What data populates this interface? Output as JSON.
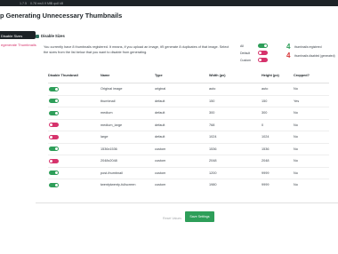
{
  "topbar": {
    "items": [
      "",
      "1.7.5",
      "0.78 ms",
      "0.9 MB",
      "3 qu",
      "8 kB"
    ]
  },
  "page": {
    "title": "p Generating Unnecessary Thumbnails"
  },
  "sidebar": {
    "items": [
      {
        "label": "Disable Sizes",
        "active": true
      },
      {
        "label": "egenerate Thumbnails",
        "active": false
      }
    ]
  },
  "section": {
    "title": "Disable Sizes",
    "description": "You currently have 8 thumbnails registered. It means, if you upload an image, it'll generate 8 duplicates of that image. Select the sizes from the list below that you want to disable from generating."
  },
  "filters": [
    {
      "label": "All",
      "state": "on"
    },
    {
      "label": "Default",
      "state": "off"
    },
    {
      "label": "Custom",
      "state": "off"
    }
  ],
  "counts": [
    {
      "value": "4",
      "label": "thumbnails registered",
      "color": "#2e9e59"
    },
    {
      "value": "4",
      "label": "thumbnails disabled (generated)",
      "color": "#d63638"
    }
  ],
  "table": {
    "headers": [
      "Disable Thumbnail",
      "Name",
      "Type",
      "Width (px)",
      "Height (px)",
      "Cropped?"
    ],
    "rows": [
      {
        "toggle": "on",
        "name": "Original image",
        "type": "original",
        "width": "auto",
        "height": "auto",
        "cropped": "No"
      },
      {
        "toggle": "on",
        "name": "thumbnail",
        "type": "default",
        "width": "150",
        "height": "150",
        "cropped": "Yes"
      },
      {
        "toggle": "on",
        "name": "medium",
        "type": "default",
        "width": "300",
        "height": "300",
        "cropped": "No"
      },
      {
        "toggle": "off",
        "name": "medium_large",
        "type": "default",
        "width": "768",
        "height": "0",
        "cropped": "No"
      },
      {
        "toggle": "off",
        "name": "large",
        "type": "default",
        "width": "1024",
        "height": "1024",
        "cropped": "No"
      },
      {
        "toggle": "on",
        "name": "1536x1536",
        "type": "custom",
        "width": "1536",
        "height": "1536",
        "cropped": "No"
      },
      {
        "toggle": "off",
        "name": "2048x2048",
        "type": "custom",
        "width": "2048",
        "height": "2048",
        "cropped": "No"
      },
      {
        "toggle": "on",
        "name": "post-thumbnail",
        "type": "custom",
        "width": "1200",
        "height": "9999",
        "cropped": "No"
      },
      {
        "toggle": "on",
        "name": "twentytwenty-fullscreen",
        "type": "custom",
        "width": "1980",
        "height": "9999",
        "cropped": "No"
      }
    ]
  },
  "footer": {
    "reset_label": "Reset Values",
    "save_label": "Save Settings"
  },
  "colors": {
    "toggle_on": "#2e9e59",
    "toggle_off": "#d6336c",
    "sidebar_active": "#1d2327",
    "save_button": "#2e9e59"
  }
}
